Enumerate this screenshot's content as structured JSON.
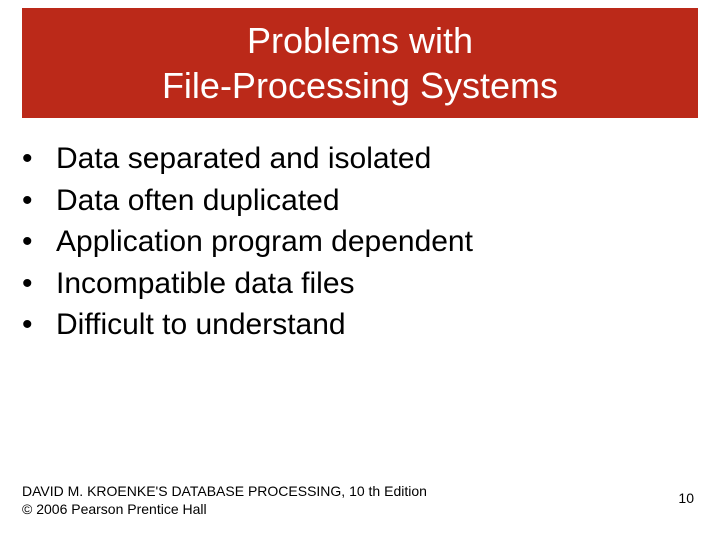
{
  "title": {
    "line1": "Problems with",
    "line2": "File-Processing Systems"
  },
  "bullets": [
    "Data separated and isolated",
    "Data often duplicated",
    "Application program dependent",
    "Incompatible data files",
    "Difficult to understand"
  ],
  "footer": {
    "line1": "DAVID M. KROENKE'S DATABASE PROCESSING, 10 th Edition",
    "line2": "© 2006 Pearson Prentice Hall",
    "page": "10"
  }
}
